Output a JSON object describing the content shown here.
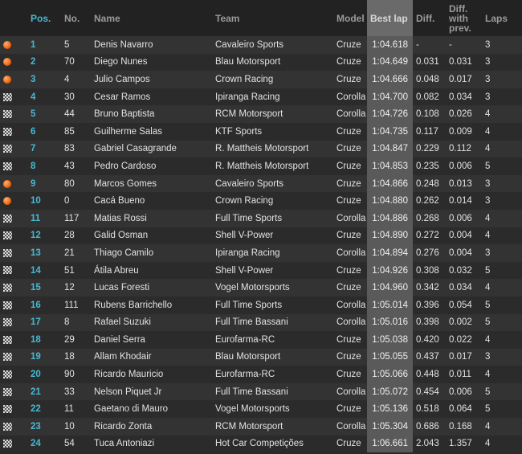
{
  "headers": {
    "pos": "Pos.",
    "no": "No.",
    "name": "Name",
    "team": "Team",
    "model": "Model",
    "best_lap": "Best lap",
    "diff": "Diff.",
    "diff_prev": "Diff. with prev.",
    "laps": "Laps"
  },
  "rows": [
    {
      "icon": "orange-dot-icon",
      "pos": "1",
      "no": "5",
      "name": "Denis Navarro",
      "team": "Cavaleiro Sports",
      "model": "Cruze",
      "best": "1:04.618",
      "diff": "-",
      "diffprev": "-",
      "laps": "3"
    },
    {
      "icon": "orange-dot-icon",
      "pos": "2",
      "no": "70",
      "name": "Diego Nunes",
      "team": "Blau Motorsport",
      "model": "Cruze",
      "best": "1:04.649",
      "diff": "0.031",
      "diffprev": "0.031",
      "laps": "3"
    },
    {
      "icon": "orange-dot-icon",
      "pos": "3",
      "no": "4",
      "name": "Julio Campos",
      "team": "Crown Racing",
      "model": "Cruze",
      "best": "1:04.666",
      "diff": "0.048",
      "diffprev": "0.017",
      "laps": "3"
    },
    {
      "icon": "checkered-flag-icon",
      "pos": "4",
      "no": "30",
      "name": "Cesar Ramos",
      "team": "Ipiranga Racing",
      "model": "Corolla",
      "best": "1:04.700",
      "diff": "0.082",
      "diffprev": "0.034",
      "laps": "3"
    },
    {
      "icon": "checkered-flag-icon",
      "pos": "5",
      "no": "44",
      "name": "Bruno Baptista",
      "team": "RCM Motorsport",
      "model": "Corolla",
      "best": "1:04.726",
      "diff": "0.108",
      "diffprev": "0.026",
      "laps": "4"
    },
    {
      "icon": "checkered-flag-icon",
      "pos": "6",
      "no": "85",
      "name": "Guilherme Salas",
      "team": "KTF Sports",
      "model": "Cruze",
      "best": "1:04.735",
      "diff": "0.117",
      "diffprev": "0.009",
      "laps": "4"
    },
    {
      "icon": "checkered-flag-icon",
      "pos": "7",
      "no": "83",
      "name": "Gabriel Casagrande",
      "team": "R. Mattheis Motorsport",
      "model": "Cruze",
      "best": "1:04.847",
      "diff": "0.229",
      "diffprev": "0.112",
      "laps": "4"
    },
    {
      "icon": "checkered-flag-icon",
      "pos": "8",
      "no": "43",
      "name": "Pedro Cardoso",
      "team": "R. Mattheis Motorsport",
      "model": "Cruze",
      "best": "1:04.853",
      "diff": "0.235",
      "diffprev": "0.006",
      "laps": "5"
    },
    {
      "icon": "orange-dot-icon",
      "pos": "9",
      "no": "80",
      "name": "Marcos Gomes",
      "team": "Cavaleiro Sports",
      "model": "Cruze",
      "best": "1:04.866",
      "diff": "0.248",
      "diffprev": "0.013",
      "laps": "3"
    },
    {
      "icon": "orange-dot-icon",
      "pos": "10",
      "no": "0",
      "name": "Cacá Bueno",
      "team": "Crown Racing",
      "model": "Cruze",
      "best": "1:04.880",
      "diff": "0.262",
      "diffprev": "0.014",
      "laps": "3"
    },
    {
      "icon": "checkered-flag-icon",
      "pos": "11",
      "no": "117",
      "name": "Matias Rossi",
      "team": "Full Time Sports",
      "model": "Corolla",
      "best": "1:04.886",
      "diff": "0.268",
      "diffprev": "0.006",
      "laps": "4"
    },
    {
      "icon": "checkered-flag-icon",
      "pos": "12",
      "no": "28",
      "name": "Galid Osman",
      "team": "Shell V-Power",
      "model": "Cruze",
      "best": "1:04.890",
      "diff": "0.272",
      "diffprev": "0.004",
      "laps": "4"
    },
    {
      "icon": "checkered-flag-icon",
      "pos": "13",
      "no": "21",
      "name": "Thiago Camilo",
      "team": "Ipiranga Racing",
      "model": "Corolla",
      "best": "1:04.894",
      "diff": "0.276",
      "diffprev": "0.004",
      "laps": "3"
    },
    {
      "icon": "checkered-flag-icon",
      "pos": "14",
      "no": "51",
      "name": "Átila Abreu",
      "team": "Shell V-Power",
      "model": "Cruze",
      "best": "1:04.926",
      "diff": "0.308",
      "diffprev": "0.032",
      "laps": "5"
    },
    {
      "icon": "checkered-flag-icon",
      "pos": "15",
      "no": "12",
      "name": "Lucas Foresti",
      "team": "Vogel Motorsports",
      "model": "Cruze",
      "best": "1:04.960",
      "diff": "0.342",
      "diffprev": "0.034",
      "laps": "4"
    },
    {
      "icon": "checkered-flag-icon",
      "pos": "16",
      "no": "111",
      "name": "Rubens Barrichello",
      "team": "Full Time Sports",
      "model": "Corolla",
      "best": "1:05.014",
      "diff": "0.396",
      "diffprev": "0.054",
      "laps": "5"
    },
    {
      "icon": "checkered-flag-icon",
      "pos": "17",
      "no": "8",
      "name": "Rafael Suzuki",
      "team": "Full Time Bassani",
      "model": "Corolla",
      "best": "1:05.016",
      "diff": "0.398",
      "diffprev": "0.002",
      "laps": "5"
    },
    {
      "icon": "checkered-flag-icon",
      "pos": "18",
      "no": "29",
      "name": "Daniel Serra",
      "team": "Eurofarma-RC",
      "model": "Cruze",
      "best": "1:05.038",
      "diff": "0.420",
      "diffprev": "0.022",
      "laps": "4"
    },
    {
      "icon": "checkered-flag-icon",
      "pos": "19",
      "no": "18",
      "name": "Allam Khodair",
      "team": "Blau Motorsport",
      "model": "Cruze",
      "best": "1:05.055",
      "diff": "0.437",
      "diffprev": "0.017",
      "laps": "3"
    },
    {
      "icon": "checkered-flag-icon",
      "pos": "20",
      "no": "90",
      "name": "Ricardo Mauricio",
      "team": "Eurofarma-RC",
      "model": "Cruze",
      "best": "1:05.066",
      "diff": "0.448",
      "diffprev": "0.011",
      "laps": "4"
    },
    {
      "icon": "checkered-flag-icon",
      "pos": "21",
      "no": "33",
      "name": "Nelson Piquet Jr",
      "team": "Full Time Bassani",
      "model": "Corolla",
      "best": "1:05.072",
      "diff": "0.454",
      "diffprev": "0.006",
      "laps": "5"
    },
    {
      "icon": "checkered-flag-icon",
      "pos": "22",
      "no": "11",
      "name": "Gaetano di Mauro",
      "team": "Vogel Motorsports",
      "model": "Cruze",
      "best": "1:05.136",
      "diff": "0.518",
      "diffprev": "0.064",
      "laps": "5"
    },
    {
      "icon": "checkered-flag-icon",
      "pos": "23",
      "no": "10",
      "name": "Ricardo Zonta",
      "team": "RCM Motorsport",
      "model": "Corolla",
      "best": "1:05.304",
      "diff": "0.686",
      "diffprev": "0.168",
      "laps": "4"
    },
    {
      "icon": "checkered-flag-icon",
      "pos": "24",
      "no": "54",
      "name": "Tuca Antoniazi",
      "team": "Hot Car Competições",
      "model": "Cruze",
      "best": "1:06.661",
      "diff": "2.043",
      "diffprev": "1.357",
      "laps": "4"
    }
  ]
}
